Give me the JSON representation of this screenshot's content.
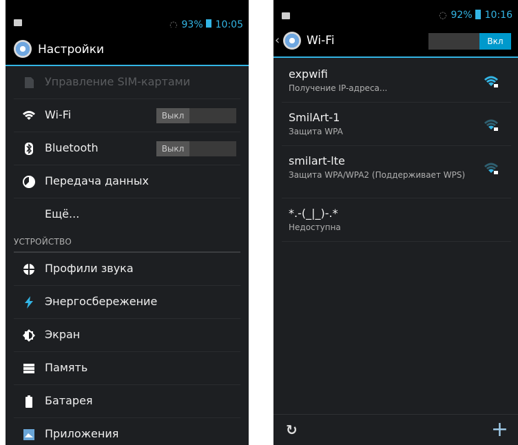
{
  "left": {
    "status": {
      "battery": "93%",
      "time": "10:05"
    },
    "title": "Настройки",
    "items": [
      {
        "label": "Управление SIM-картами",
        "icon": "sim-card-icon",
        "disabled": true
      },
      {
        "label": "Wi-Fi",
        "icon": "wifi-icon",
        "toggle": "Выкл"
      },
      {
        "label": "Bluetooth",
        "icon": "bluetooth-icon",
        "toggle": "Выкл"
      },
      {
        "label": "Передача данных",
        "icon": "data-usage-icon"
      },
      {
        "label": "Ещё...",
        "icon": ""
      }
    ],
    "section": "УСТРОЙСТВО",
    "device_items": [
      {
        "label": "Профили звука",
        "icon": "sound-profile-icon"
      },
      {
        "label": "Энергосбережение",
        "icon": "power-saving-icon"
      },
      {
        "label": "Экран",
        "icon": "display-icon"
      },
      {
        "label": "Память",
        "icon": "storage-icon"
      },
      {
        "label": "Батарея",
        "icon": "battery-icon"
      },
      {
        "label": "Приложения",
        "icon": "apps-icon"
      }
    ]
  },
  "right": {
    "status": {
      "battery": "92%",
      "time": "10:16"
    },
    "title": "Wi-Fi",
    "toggle": "Вкл",
    "networks": [
      {
        "ssid": "expwifi",
        "sub": "Получение IP-адреса...",
        "signal": "strong"
      },
      {
        "ssid": "SmilArt-1",
        "sub": "Защита WPA",
        "signal": "weak"
      },
      {
        "ssid": "smilart-lte",
        "sub": "Защита WPA/WPA2 (Поддерживает WPS)",
        "signal": "weak"
      },
      {
        "ssid": "*.-(_|_)-.*",
        "sub": "Недоступна",
        "signal": ""
      }
    ]
  },
  "colors": {
    "accent": "#33b5e5",
    "background": "#1d1f22",
    "toggle_on": "#0099cc"
  }
}
